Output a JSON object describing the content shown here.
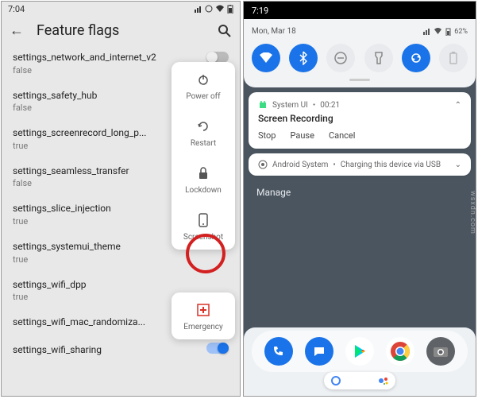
{
  "left": {
    "status_time": "7:04",
    "header_title": "Feature flags",
    "flags": [
      {
        "name": "settings_network_and_internet_v2",
        "val": "false"
      },
      {
        "name": "settings_safety_hub",
        "val": "false"
      },
      {
        "name": "settings_screenrecord_long_p...",
        "val": "true"
      },
      {
        "name": "settings_seamless_transfer",
        "val": "false"
      },
      {
        "name": "settings_slice_injection",
        "val": "true"
      },
      {
        "name": "settings_systemui_theme",
        "val": "true"
      },
      {
        "name": "settings_wifi_dpp",
        "val": "true"
      },
      {
        "name": "settings_wifi_mac_randomiza...",
        "val": ""
      },
      {
        "name": "settings_wifi_sharing",
        "val": ""
      }
    ],
    "power_menu": {
      "power_off": "Power off",
      "restart": "Restart",
      "lockdown": "Lockdown",
      "screenshot": "Screenshot",
      "emergency": "Emergency"
    }
  },
  "right": {
    "status_time": "7:19",
    "date": "Mon, Mar 18",
    "battery": "62%",
    "notif1": {
      "app": "System UI",
      "time": "00:21",
      "title": "Screen Recording",
      "actions": [
        "Stop",
        "Pause",
        "Cancel"
      ]
    },
    "notif2": {
      "app": "Android System",
      "text": "Charging this device via USB"
    },
    "manage": "Manage"
  },
  "watermark": "wsxdn.com"
}
